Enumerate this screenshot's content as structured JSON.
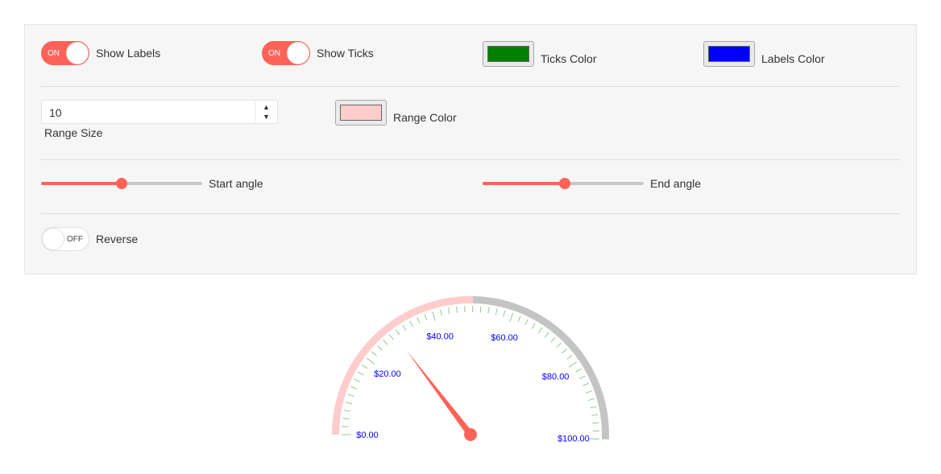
{
  "controls": {
    "show_labels": {
      "state": "ON",
      "label": "Show Labels"
    },
    "show_ticks": {
      "state": "ON",
      "label": "Show Ticks"
    },
    "ticks_color": {
      "label": "Ticks Color",
      "color": "#008000"
    },
    "labels_color": {
      "label": "Labels Color",
      "color": "#0000ff"
    },
    "range_size": {
      "value": "10",
      "label": "Range Size",
      "up_icon": "▲",
      "down_icon": "▼"
    },
    "range_color": {
      "label": "Range Color",
      "color": "#ffcccc"
    },
    "start_angle": {
      "label": "Start angle",
      "fraction": 0.5
    },
    "end_angle": {
      "label": "End angle",
      "fraction": 0.51
    },
    "reverse": {
      "state": "OFF",
      "label": "Reverse"
    }
  },
  "theme": {
    "accent": "#ff6358",
    "range_rest_color": "#c4c4c4",
    "tick_color": "#8fc88f",
    "label_color": "#0000ff"
  },
  "gauge": {
    "type": "arc-gauge",
    "min": 0,
    "max": 100,
    "value": 29,
    "range_from": 0,
    "range_to": 50,
    "major_unit": 20,
    "minor_unit": 2,
    "labels": [
      "$0.00",
      "$20.00",
      "$40.00",
      "$60.00",
      "$80.00",
      "$100.00"
    ]
  }
}
